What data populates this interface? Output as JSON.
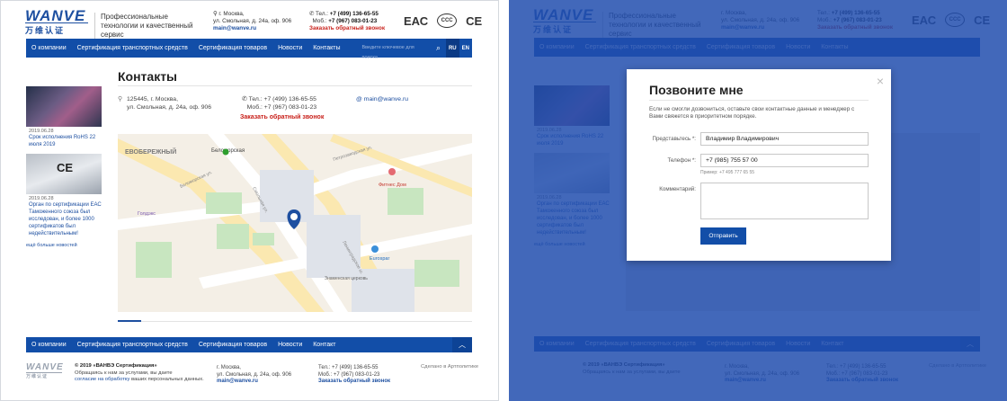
{
  "header": {
    "logo_top": "WANVE",
    "logo_cn": "万维认证",
    "slogan": "Профессиональные технологии и качественный сервис",
    "address_line1": "г. Москва,",
    "address_line2": "ул. Смольная, д. 24а, оф. 906",
    "email": "main@wanve.ru",
    "tel_label": "Тел.:",
    "tel": "+7 (499) 136-65-55",
    "mob_label": "Моб.:",
    "mob": "+7 (967) 083-01-23",
    "callback": "Заказать обратный звонок",
    "cert_eac": "ЕАС",
    "cert_ccc": "CCC",
    "cert_ce": "CE"
  },
  "nav": {
    "items": [
      "О компании",
      "Сертификация транспортных средств",
      "Сертификация товаров",
      "Новости",
      "Контакты"
    ],
    "search_placeholder": "Введите ключевое для поиска",
    "lang_ru": "RU",
    "lang_en": "EN"
  },
  "news": [
    {
      "date": "2019.06.28",
      "title": "Срок исполнения RoHS 22 июля 2019"
    },
    {
      "date": "2019.06.28",
      "title": "Орган по сертификации ЕАС Таможенного союза был исследован, и более 1000 сертификатов был недействительным!"
    }
  ],
  "news_more": "ещё больше новостей",
  "page_title": "Контакты",
  "contacts": {
    "addr1": "125445, г. Москва,",
    "addr2": "ул. Смольная, д. 24а, оф. 906",
    "tel": "Тел.: +7 (499) 136-65-55",
    "mob": "Моб.: +7 (967) 083-01-23",
    "callback": "Заказать обратный звонок",
    "email": "main@wanve.ru"
  },
  "map_labels": {
    "district": "ЕВОБЕРЕЖНЫЙ",
    "belomorskaya": "Беломорская",
    "metro": "Беломорская",
    "fitness": "Фитнес Дом",
    "goodfit": "Голдэкс",
    "eurospar": "Eurospar",
    "church": "Знаменская церковь",
    "street1": "Беломорская ул.",
    "street2": "Петрозаводская ул.",
    "street3": "Смольная ул.",
    "street4": "Ленинградское ш."
  },
  "footer_nav": {
    "items": [
      "О компании",
      "Сертификация транспортных средств",
      "Сертификация товаров",
      "Новости",
      "Контакт"
    ],
    "up": "︿"
  },
  "footer": {
    "logo_top": "WANVE",
    "logo_cn": "万维认证",
    "copyright": "© 2019 «ВАНВЭ Сертификация»",
    "text1": "Обращаясь к нам за услугами, вы даете",
    "link": "согласие на обработку",
    "text2": "ваших персональных данных.",
    "addr1": "г. Москва,",
    "addr2": "ул. Смольная, д. 24а, оф. 906",
    "email": "main@wanve.ru",
    "tel": "Тел.: +7 (499) 136-65-55",
    "mob": "Моб.: +7 (967) 083-01-23",
    "callback": "Заказать обратный звонок",
    "made": "Сделано в Артполитике"
  },
  "modal": {
    "title": "Позвоните мне",
    "description": "Если не смогли дозвониться, оставьте свои контактные данные и менеджер с Вами свяжется в приоритетном порядке.",
    "name_label": "Представьтесь *:",
    "name_value": "Владимир Владимирович",
    "phone_label": "Телефон *:",
    "phone_value": "+7 (985) 755 57 00",
    "phone_hint": "Пример: +7 495 777 65 55",
    "comment_label": "Комментарий:",
    "comment_value": "",
    "submit": "Отправить",
    "close": "×"
  },
  "colors": {
    "brand_blue": "#124ea8",
    "overlay": "#214dae",
    "callback_red": "#c8201a"
  }
}
